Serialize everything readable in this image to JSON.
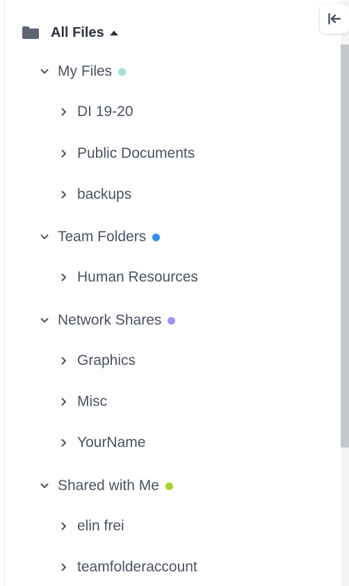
{
  "colors": {
    "text": "#4a5263",
    "root_text": "#2b3140",
    "folder_icon": "#5f6673",
    "scrollbar": "#c4c7cc"
  },
  "tree": {
    "root": {
      "label": "All Files",
      "icon": "folder-icon",
      "expanded": true
    },
    "sections": [
      {
        "label": "My Files",
        "dot_color": "#a8dde0",
        "expanded": true,
        "children": [
          "DI 19-20",
          "Public Documents",
          "backups"
        ]
      },
      {
        "label": "Team Folders",
        "dot_color": "#2f8ff0",
        "expanded": true,
        "children": [
          "Human Resources"
        ]
      },
      {
        "label": "Network Shares",
        "dot_color": "#a98df5",
        "expanded": true,
        "children": [
          "Graphics",
          "Misc",
          "YourName"
        ]
      },
      {
        "label": "Shared with Me",
        "dot_color": "#a6d32a",
        "expanded": true,
        "children": [
          "elin frei",
          "teamfolderaccount"
        ]
      }
    ]
  },
  "collapse_button": {
    "icon": "collapse-left-icon"
  }
}
